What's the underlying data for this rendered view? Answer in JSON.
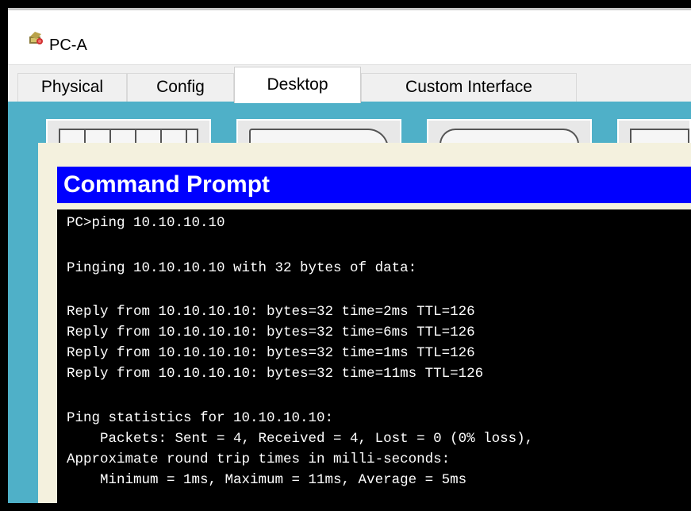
{
  "window": {
    "title": "PC-A",
    "icon": "packet-tracer-pc-icon"
  },
  "tabs": [
    {
      "label": "Physical",
      "active": false
    },
    {
      "label": "Config",
      "active": false
    },
    {
      "label": "Desktop",
      "active": true
    },
    {
      "label": "Custom Interface",
      "active": false
    }
  ],
  "command_prompt": {
    "title": "Command Prompt",
    "lines": [
      "PC>ping 10.10.10.10",
      "Pinging 10.10.10.10 with 32 bytes of data:",
      "Reply from 10.10.10.10: bytes=32 time=2ms TTL=126",
      "Reply from 10.10.10.10: bytes=32 time=6ms TTL=126",
      "Reply from 10.10.10.10: bytes=32 time=1ms TTL=126",
      "Reply from 10.10.10.10: bytes=32 time=11ms TTL=126",
      "Ping statistics for 10.10.10.10:",
      "    Packets: Sent = 4, Received = 4, Lost = 0 (0% loss),",
      "Approximate round trip times in milli-seconds:",
      "    Minimum = 1ms, Maximum = 11ms, Average = 5ms"
    ]
  },
  "colors": {
    "desktop_bg": "#4fb0c8",
    "prompt_title_bg": "#0000ff",
    "terminal_bg": "#000000",
    "terminal_fg": "#ffffff"
  }
}
